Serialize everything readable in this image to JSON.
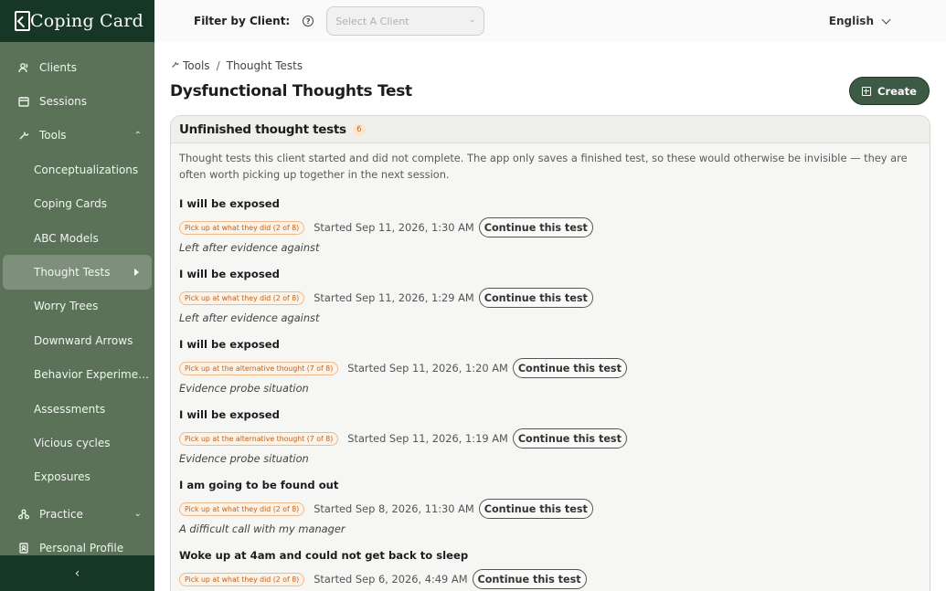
{
  "app": {
    "name": "Coping Card"
  },
  "sidebar": {
    "items": [
      {
        "label": "Clients",
        "icon": "users-icon"
      },
      {
        "label": "Sessions",
        "icon": "calendar-icon"
      },
      {
        "label": "Tools",
        "icon": "wrench-icon",
        "expanded": true
      },
      {
        "label": "Conceptualizations"
      },
      {
        "label": "Coping Cards"
      },
      {
        "label": "ABC Models"
      },
      {
        "label": "Thought Tests",
        "active": true
      },
      {
        "label": "Worry Trees"
      },
      {
        "label": "Downward Arrows"
      },
      {
        "label": "Behavior Experime…"
      },
      {
        "label": "Assessments"
      },
      {
        "label": "Vicious cycles"
      },
      {
        "label": "Exposures"
      },
      {
        "label": "Practice",
        "icon": "practice-icon",
        "expanded": false
      },
      {
        "label": "Personal Profile",
        "icon": "profile-icon"
      }
    ],
    "collapse_icon": "chevron-left-icon"
  },
  "topbar": {
    "filter_label": "Filter by Client:",
    "client_placeholder": "Select A Client",
    "language": "English"
  },
  "breadcrumb": {
    "root": "Tools",
    "separator": "/",
    "current": "Thought Tests"
  },
  "page": {
    "title": "Dysfunctional Thoughts Test",
    "create_label": "Create"
  },
  "unfinished": {
    "title": "Unfinished thought tests",
    "count": "6",
    "description": "Thought tests this client started and did not complete. The app only saves a finished test, so these would otherwise be invisible — they are often worth picking up together in the next session.",
    "continue_label": "Continue this test",
    "tests": [
      {
        "title": "I will be exposed",
        "badge": "Pick up at what they did (2 of 8)",
        "started": "Started Sep 11, 2026, 1:30 AM",
        "note": "Left after evidence against"
      },
      {
        "title": "I will be exposed",
        "badge": "Pick up at what they did (2 of 8)",
        "started": "Started Sep 11, 2026, 1:29 AM",
        "note": "Left after evidence against"
      },
      {
        "title": "I will be exposed",
        "badge": "Pick up at the alternative thought (7 of 8)",
        "started": "Started Sep 11, 2026, 1:20 AM",
        "note": "Evidence probe situation"
      },
      {
        "title": "I will be exposed",
        "badge": "Pick up at the alternative thought (7 of 8)",
        "started": "Started Sep 11, 2026, 1:19 AM",
        "note": "Evidence probe situation"
      },
      {
        "title": "I am going to be found out",
        "badge": "Pick up at what they did (2 of 8)",
        "started": "Started Sep 8, 2026, 11:30 AM",
        "note": "A difficult call with my manager"
      },
      {
        "title": "Woke up at 4am and could not get back to sleep",
        "badge": "Pick up at what they did (2 of 8)",
        "started": "Started Sep 6, 2026, 4:49 AM",
        "note": ""
      }
    ]
  },
  "colors": {
    "sidebar_bg": "#5b7259",
    "sidebar_dark": "#163626",
    "accent": "#3c5a44",
    "badge_orange": "#c4611a"
  }
}
